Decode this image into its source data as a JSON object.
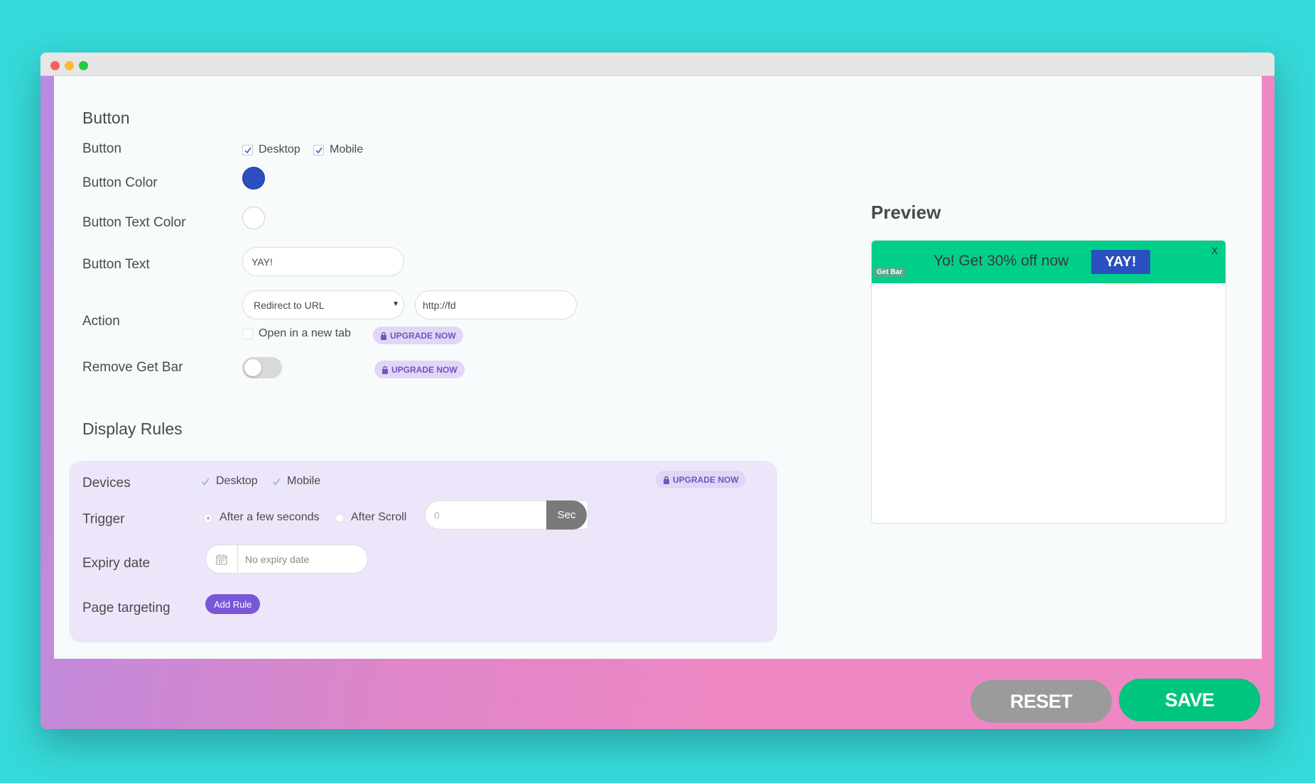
{
  "button_section": {
    "title": "Button",
    "button_label": "Button",
    "desktop_label": "Desktop",
    "mobile_label": "Mobile",
    "desktop_checked": true,
    "mobile_checked": true,
    "button_color_label": "Button Color",
    "button_color": "#2a4fbf",
    "button_text_color_label": "Button Text Color",
    "button_text_color": "#ffffff",
    "button_text_label": "Button Text",
    "button_text_value": "YAY!",
    "action_label": "Action",
    "action_select_value": "Redirect to URL",
    "action_url_value": "http://fd",
    "open_new_tab_label": "Open in a new tab",
    "open_new_tab_checked": false,
    "upgrade_label": "UPGRADE NOW",
    "remove_get_bar_label": "Remove Get Bar",
    "remove_get_bar_on": false
  },
  "display_rules": {
    "title": "Display Rules",
    "devices_label": "Devices",
    "desktop_label": "Desktop",
    "mobile_label": "Mobile",
    "upgrade_label": "UPGRADE NOW",
    "trigger_label": "Trigger",
    "trigger_option_1": "After a few seconds",
    "trigger_option_2": "After Scroll",
    "trigger_value": "0",
    "trigger_unit": "Sec",
    "expiry_label": "Expiry date",
    "expiry_placeholder": "No expiry date",
    "page_targeting_label": "Page targeting",
    "add_rule_label": "Add Rule"
  },
  "preview": {
    "title": "Preview",
    "bar_text": "Yo! Get 30% off now",
    "bar_button": "YAY!",
    "close_label": "X",
    "brand_badge": "Get Bar",
    "bar_color": "#00cf8a"
  },
  "footer": {
    "reset_label": "RESET",
    "save_label": "SAVE",
    "reset_color": "#9b9b9b",
    "save_color": "#00c57f"
  },
  "colors": {
    "accent": "#7a56d8",
    "background": "#36d9d9"
  }
}
